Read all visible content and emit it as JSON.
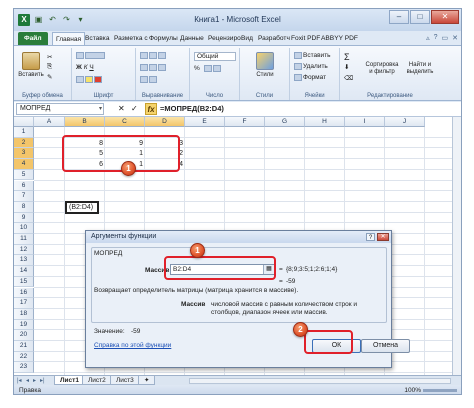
{
  "window": {
    "title": "Книга1 - Microsoft Excel"
  },
  "tabs": [
    "Файл",
    "Главная",
    "Вставка",
    "Разметка с",
    "Формулы",
    "Данные",
    "Рецензиро",
    "Вид",
    "Разработч",
    "Foxit PDF",
    "ABBYY PDF"
  ],
  "ribbon": {
    "clipboard": {
      "paste": "Вставить",
      "label": "Буфер обмена"
    },
    "font": {
      "label": "Шрифт",
      "bold": "Ж",
      "italic": "К",
      "underline": "Ч"
    },
    "alignment": {
      "label": "Выравнивание"
    },
    "number": {
      "label": "Число",
      "format": "Общий",
      "percent": "%"
    },
    "styles": {
      "button": "Стили",
      "label": "Стили"
    },
    "cells": {
      "insert": "Вставить",
      "delete": "Удалить",
      "format": "Формат",
      "label": "Ячейки"
    },
    "editing": {
      "sort": "Сортировка и фильтр",
      "find": "Найти и выделить",
      "label": "Редактирование"
    }
  },
  "formula_bar": {
    "name_box": "МОПРЕД",
    "cancel": "✕",
    "enter": "✓",
    "fx": "fx",
    "formula": "=МОПРЕД(B2:D4)"
  },
  "columns": [
    "A",
    "B",
    "C",
    "D",
    "E",
    "F",
    "G",
    "H",
    "I",
    "J"
  ],
  "rows": [
    "1",
    "2",
    "3",
    "4",
    "5",
    "6",
    "7",
    "8",
    "9",
    "10",
    "11",
    "12",
    "13",
    "14",
    "15",
    "16",
    "17",
    "18",
    "19",
    "20",
    "21",
    "22",
    "23"
  ],
  "cells": [
    {
      "row": 2,
      "values": [
        "8",
        "9",
        "3"
      ]
    },
    {
      "row": 3,
      "values": [
        "5",
        "1",
        "2"
      ]
    },
    {
      "row": 4,
      "values": [
        "6",
        "1",
        "4"
      ]
    }
  ],
  "active_cell": "(B2:D4)",
  "badges": [
    "1",
    "1",
    "2"
  ],
  "dialog": {
    "title": "Аргументы функции",
    "help": "?",
    "close": "✕",
    "function_name": "МОПРЕД",
    "arg_label": "Массив",
    "arg_value": "B2:D4",
    "arg_eq": "=",
    "arg_result": "{8;9;3:5;1;2:6;1;4}",
    "res_eq": "=",
    "result": "-59",
    "description": "Возвращает определитель матрицы (матрица хранится в массиве).",
    "arg_name": "Массив",
    "arg_description": "числовой массив с равным количеством строк и столбцов, диапазон ячеек или массив.",
    "value_label": "Значение:",
    "value": "-59",
    "help_link": "Справка по этой функции",
    "ok": "ОК",
    "cancel": "Отмена"
  },
  "sheets": [
    "Лист1",
    "Лист2",
    "Лист3"
  ],
  "status": {
    "mode": "Правка",
    "zoom": "100%"
  },
  "colors": {
    "accent": "#2a7d3a",
    "frame": "#e0202a",
    "badge": "#e0542c"
  }
}
